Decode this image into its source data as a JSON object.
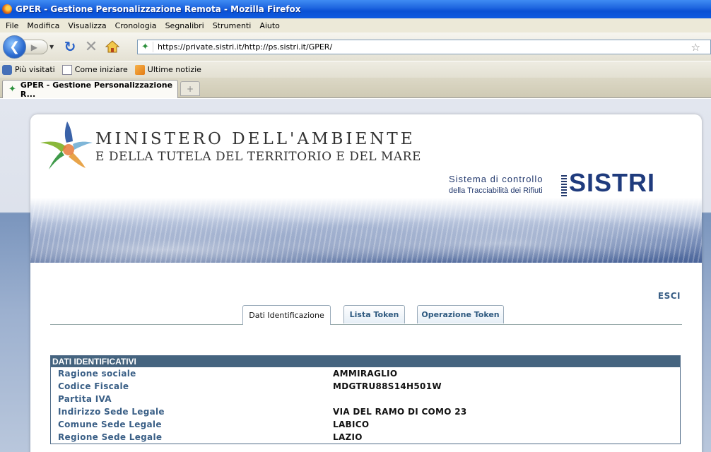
{
  "window": {
    "title": "GPER - Gestione Personalizzazione Remota - Mozilla Firefox"
  },
  "menu": [
    {
      "label": "File"
    },
    {
      "label": "Modifica"
    },
    {
      "label": "Visualizza"
    },
    {
      "label": "Cronologia"
    },
    {
      "label": "Segnalibri"
    },
    {
      "label": "Strumenti"
    },
    {
      "label": "Aiuto"
    }
  ],
  "navigation": {
    "url": "https://private.sistri.it/http://ps.sistri.it/GPER/"
  },
  "bookmarks": [
    {
      "label": "Più visitati",
      "icon": "most-visited-icon"
    },
    {
      "label": "Come iniziare",
      "icon": "page-icon"
    },
    {
      "label": "Ultime notizie",
      "icon": "rss-icon"
    }
  ],
  "tab": {
    "label": "GPER - Gestione Personalizzazione R...",
    "new_tab": "+"
  },
  "header": {
    "ministry_line1": "MINISTERO DELL'AMBIENTE",
    "ministry_line2": "E DELLA TUTELA DEL TERRITORIO E DEL MARE",
    "sistri_line1": "Sistema di controllo",
    "sistri_line2": "della Tracciabilità dei Rifiuti",
    "sistri_brand": "SISTRI"
  },
  "actions": {
    "logout": "ESCI"
  },
  "page_tabs": [
    {
      "label": "Dati Identificazione",
      "active": true
    },
    {
      "label": "Lista Token",
      "active": false
    },
    {
      "label": "Operazione Token",
      "active": false
    }
  ],
  "section": {
    "title": "DATI IDENTIFICATIVI",
    "rows": [
      {
        "label": "Ragione sociale",
        "value": "AMMIRAGLIO"
      },
      {
        "label": "Codice Fiscale",
        "value": "MDGTRU88S14H501W"
      },
      {
        "label": "Partita IVA",
        "value": ""
      },
      {
        "label": "Indirizzo Sede Legale",
        "value": "VIA DEL RAMO DI COMO 23"
      },
      {
        "label": "Comune Sede Legale",
        "value": "LABICO"
      },
      {
        "label": "Regione Sede Legale",
        "value": "LAZIO"
      }
    ]
  },
  "colors": {
    "accent": "#45647f",
    "label_text": "#3a5f86",
    "brand": "#1f3b7d"
  }
}
